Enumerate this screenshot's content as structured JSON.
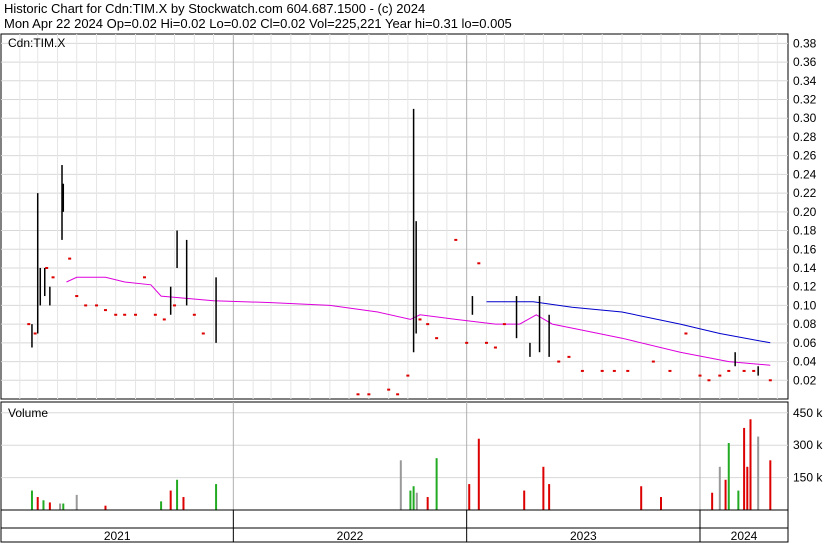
{
  "header": {
    "line1": "Historic Chart for Cdn:TIM.X by Stockwatch.com 604.687.1500 - (c) 2024",
    "line2": "Mon Apr 22 2024   Op=0.02  Hi=0.02  Lo=0.02  Cl=0.02  Vol=225,221  Year hi=0.31  lo=0.005"
  },
  "chart_data": [
    {
      "type": "line",
      "title": "Cdn:TIM.X",
      "ylim": [
        0,
        0.39
      ],
      "yticks": [
        "0.02",
        "0.04",
        "0.06",
        "0.08",
        "0.10",
        "0.12",
        "0.14",
        "0.16",
        "0.18",
        "0.20",
        "0.22",
        "0.24",
        "0.26",
        "0.28",
        "0.30",
        "0.32",
        "0.34",
        "0.36",
        "0.38"
      ],
      "x_labels": [
        "2021",
        "2022",
        "2023",
        "2024"
      ],
      "x_range": [
        "2020-10",
        "2024-05"
      ],
      "grid": true,
      "colors": {
        "price_up": "#000000",
        "price_dot": "#dd0000",
        "ma_short": "#dd00dd",
        "ma_long": "#0000cc"
      },
      "series": [
        {
          "style": "high-low bars",
          "values": [
            {
              "x": "2021-02-20",
              "low": 0.055,
              "high": 0.08
            },
            {
              "x": "2021-03-01",
              "low": 0.07,
              "high": 0.22
            },
            {
              "x": "2021-03-05",
              "low": 0.1,
              "high": 0.14
            },
            {
              "x": "2021-03-12",
              "low": 0.11,
              "high": 0.14
            },
            {
              "x": "2021-03-20",
              "low": 0.1,
              "high": 0.12
            },
            {
              "x": "2021-04-08",
              "low": 0.17,
              "high": 0.25
            },
            {
              "x": "2021-04-10",
              "low": 0.2,
              "high": 0.23
            },
            {
              "x": "2021-09-25",
              "low": 0.09,
              "high": 0.12
            },
            {
              "x": "2021-10-05",
              "low": 0.14,
              "high": 0.18
            },
            {
              "x": "2021-10-20",
              "low": 0.1,
              "high": 0.17
            },
            {
              "x": "2021-12-05",
              "low": 0.06,
              "high": 0.13
            },
            {
              "x": "2022-10-10",
              "low": 0.05,
              "high": 0.31
            },
            {
              "x": "2022-10-14",
              "low": 0.07,
              "high": 0.19
            },
            {
              "x": "2023-01-10",
              "low": 0.09,
              "high": 0.11
            },
            {
              "x": "2023-03-20",
              "low": 0.065,
              "high": 0.11
            },
            {
              "x": "2023-04-10",
              "low": 0.045,
              "high": 0.06
            },
            {
              "x": "2023-04-25",
              "low": 0.05,
              "high": 0.11
            },
            {
              "x": "2023-05-10",
              "low": 0.045,
              "high": 0.09
            },
            {
              "x": "2024-02-25",
              "low": 0.035,
              "high": 0.05
            },
            {
              "x": "2024-04-01",
              "low": 0.025,
              "high": 0.035
            }
          ]
        },
        {
          "style": "close dots",
          "values": [
            {
              "x": "2021-02-15",
              "y": 0.08
            },
            {
              "x": "2021-02-25",
              "y": 0.07
            },
            {
              "x": "2021-03-15",
              "y": 0.14
            },
            {
              "x": "2021-03-25",
              "y": 0.13
            },
            {
              "x": "2021-04-20",
              "y": 0.15
            },
            {
              "x": "2021-05-01",
              "y": 0.11
            },
            {
              "x": "2021-05-15",
              "y": 0.1
            },
            {
              "x": "2021-06-01",
              "y": 0.1
            },
            {
              "x": "2021-06-15",
              "y": 0.095
            },
            {
              "x": "2021-07-01",
              "y": 0.09
            },
            {
              "x": "2021-07-15",
              "y": 0.09
            },
            {
              "x": "2021-08-01",
              "y": 0.09
            },
            {
              "x": "2021-08-15",
              "y": 0.13
            },
            {
              "x": "2021-09-01",
              "y": 0.09
            },
            {
              "x": "2021-09-15",
              "y": 0.085
            },
            {
              "x": "2021-10-01",
              "y": 0.1
            },
            {
              "x": "2021-11-01",
              "y": 0.09
            },
            {
              "x": "2021-11-15",
              "y": 0.07
            },
            {
              "x": "2022-07-15",
              "y": 0.005
            },
            {
              "x": "2022-08-01",
              "y": 0.005
            },
            {
              "x": "2022-09-01",
              "y": 0.01
            },
            {
              "x": "2022-09-15",
              "y": 0.005
            },
            {
              "x": "2022-10-01",
              "y": 0.025
            },
            {
              "x": "2022-10-20",
              "y": 0.085
            },
            {
              "x": "2022-11-01",
              "y": 0.08
            },
            {
              "x": "2022-11-15",
              "y": 0.065
            },
            {
              "x": "2022-12-15",
              "y": 0.17
            },
            {
              "x": "2023-01-01",
              "y": 0.06
            },
            {
              "x": "2023-01-20",
              "y": 0.145
            },
            {
              "x": "2023-02-01",
              "y": 0.06
            },
            {
              "x": "2023-02-15",
              "y": 0.055
            },
            {
              "x": "2023-03-01",
              "y": 0.08
            },
            {
              "x": "2023-05-25",
              "y": 0.04
            },
            {
              "x": "2023-06-10",
              "y": 0.045
            },
            {
              "x": "2023-07-01",
              "y": 0.03
            },
            {
              "x": "2023-08-01",
              "y": 0.03
            },
            {
              "x": "2023-08-20",
              "y": 0.03
            },
            {
              "x": "2023-09-10",
              "y": 0.03
            },
            {
              "x": "2023-10-20",
              "y": 0.04
            },
            {
              "x": "2023-11-15",
              "y": 0.03
            },
            {
              "x": "2023-12-10",
              "y": 0.07
            },
            {
              "x": "2024-01-01",
              "y": 0.025
            },
            {
              "x": "2024-01-15",
              "y": 0.02
            },
            {
              "x": "2024-02-01",
              "y": 0.025
            },
            {
              "x": "2024-02-15",
              "y": 0.03
            },
            {
              "x": "2024-03-10",
              "y": 0.03
            },
            {
              "x": "2024-03-25",
              "y": 0.03
            },
            {
              "x": "2024-04-20",
              "y": 0.02
            }
          ]
        },
        {
          "style": "moving average (magenta)",
          "values": [
            {
              "x": "2021-04-15",
              "y": 0.125
            },
            {
              "x": "2021-05-01",
              "y": 0.13
            },
            {
              "x": "2021-06-15",
              "y": 0.13
            },
            {
              "x": "2021-07-15",
              "y": 0.125
            },
            {
              "x": "2021-08-25",
              "y": 0.122
            },
            {
              "x": "2021-09-10",
              "y": 0.11
            },
            {
              "x": "2021-12-01",
              "y": 0.105
            },
            {
              "x": "2022-03-01",
              "y": 0.103
            },
            {
              "x": "2022-06-01",
              "y": 0.1
            },
            {
              "x": "2022-08-15",
              "y": 0.093
            },
            {
              "x": "2022-10-05",
              "y": 0.085
            },
            {
              "x": "2022-10-20",
              "y": 0.09
            },
            {
              "x": "2022-12-15",
              "y": 0.085
            },
            {
              "x": "2023-02-15",
              "y": 0.08
            },
            {
              "x": "2023-03-25",
              "y": 0.08
            },
            {
              "x": "2023-04-20",
              "y": 0.09
            },
            {
              "x": "2023-05-15",
              "y": 0.08
            },
            {
              "x": "2023-06-20",
              "y": 0.075
            },
            {
              "x": "2023-09-01",
              "y": 0.065
            },
            {
              "x": "2023-12-01",
              "y": 0.05
            },
            {
              "x": "2024-02-15",
              "y": 0.04
            },
            {
              "x": "2024-04-20",
              "y": 0.036
            }
          ]
        },
        {
          "style": "moving average (blue)",
          "values": [
            {
              "x": "2023-02-01",
              "y": 0.104
            },
            {
              "x": "2023-04-15",
              "y": 0.104
            },
            {
              "x": "2023-06-15",
              "y": 0.098
            },
            {
              "x": "2023-09-01",
              "y": 0.093
            },
            {
              "x": "2023-12-01",
              "y": 0.08
            },
            {
              "x": "2024-02-01",
              "y": 0.07
            },
            {
              "x": "2024-04-20",
              "y": 0.06
            }
          ]
        }
      ]
    },
    {
      "type": "bar",
      "title": "Volume",
      "ylim": [
        0,
        500000
      ],
      "yticks": [
        "150 k",
        "300 k",
        "450 k"
      ],
      "colors": {
        "up": "#22aa22",
        "down": "#dd0000",
        "flat": "#999999"
      },
      "bars": [
        {
          "x": "2021-02-20",
          "v": 90000,
          "c": "up"
        },
        {
          "x": "2021-03-01",
          "v": 60000,
          "c": "down"
        },
        {
          "x": "2021-03-10",
          "v": 45000,
          "c": "up"
        },
        {
          "x": "2021-03-20",
          "v": 35000,
          "c": "down"
        },
        {
          "x": "2021-04-05",
          "v": 30000,
          "c": "flat"
        },
        {
          "x": "2021-04-10",
          "v": 30000,
          "c": "up"
        },
        {
          "x": "2021-05-01",
          "v": 70000,
          "c": "flat"
        },
        {
          "x": "2021-06-15",
          "v": 20000,
          "c": "down"
        },
        {
          "x": "2021-09-10",
          "v": 40000,
          "c": "up"
        },
        {
          "x": "2021-09-25",
          "v": 90000,
          "c": "down"
        },
        {
          "x": "2021-10-05",
          "v": 140000,
          "c": "up"
        },
        {
          "x": "2021-10-15",
          "v": 60000,
          "c": "down"
        },
        {
          "x": "2021-12-05",
          "v": 120000,
          "c": "up"
        },
        {
          "x": "2022-09-20",
          "v": 230000,
          "c": "flat"
        },
        {
          "x": "2022-10-05",
          "v": 90000,
          "c": "up"
        },
        {
          "x": "2022-10-10",
          "v": 110000,
          "c": "up"
        },
        {
          "x": "2022-10-15",
          "v": 80000,
          "c": "flat"
        },
        {
          "x": "2022-11-01",
          "v": 60000,
          "c": "down"
        },
        {
          "x": "2022-11-15",
          "v": 240000,
          "c": "up"
        },
        {
          "x": "2023-01-05",
          "v": 120000,
          "c": "down"
        },
        {
          "x": "2023-01-20",
          "v": 330000,
          "c": "down"
        },
        {
          "x": "2023-04-01",
          "v": 90000,
          "c": "down"
        },
        {
          "x": "2023-05-01",
          "v": 200000,
          "c": "down"
        },
        {
          "x": "2023-05-10",
          "v": 120000,
          "c": "down"
        },
        {
          "x": "2023-10-01",
          "v": 110000,
          "c": "down"
        },
        {
          "x": "2023-11-01",
          "v": 60000,
          "c": "down"
        },
        {
          "x": "2024-01-20",
          "v": 80000,
          "c": "down"
        },
        {
          "x": "2024-02-01",
          "v": 200000,
          "c": "flat"
        },
        {
          "x": "2024-02-10",
          "v": 140000,
          "c": "down"
        },
        {
          "x": "2024-02-15",
          "v": 310000,
          "c": "up"
        },
        {
          "x": "2024-03-01",
          "v": 90000,
          "c": "up"
        },
        {
          "x": "2024-03-10",
          "v": 380000,
          "c": "down"
        },
        {
          "x": "2024-03-15",
          "v": 200000,
          "c": "down"
        },
        {
          "x": "2024-03-20",
          "v": 420000,
          "c": "down"
        },
        {
          "x": "2024-04-01",
          "v": 340000,
          "c": "flat"
        },
        {
          "x": "2024-04-20",
          "v": 230000,
          "c": "down"
        }
      ]
    }
  ]
}
